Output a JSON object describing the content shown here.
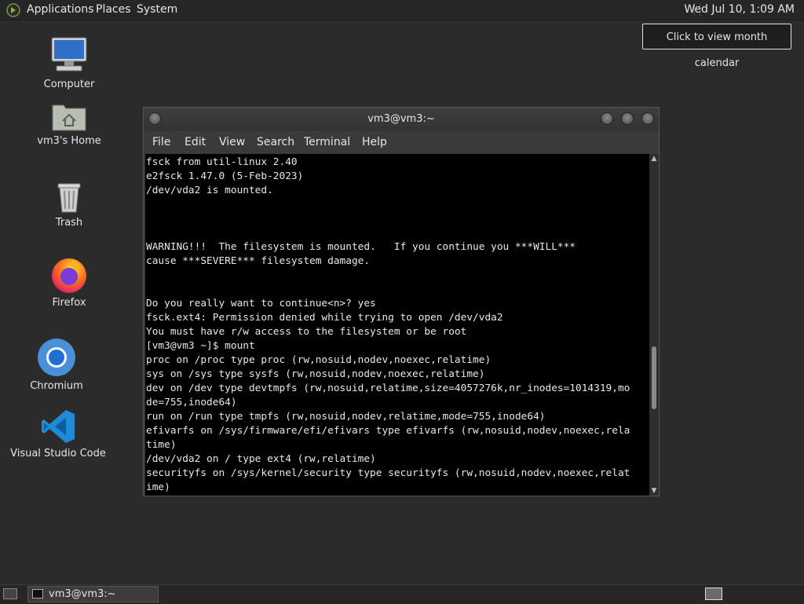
{
  "top_panel": {
    "menus": [
      "Applications",
      "Places",
      "System"
    ],
    "clock": "Wed Jul 10,  1:09 AM",
    "tooltip": "Click to view month calendar"
  },
  "desktop": {
    "icons": [
      {
        "label": "Computer",
        "icon": "computer-icon"
      },
      {
        "label": "vm3's Home",
        "icon": "home-folder-icon"
      },
      {
        "label": "Trash",
        "icon": "trash-icon"
      },
      {
        "label": "Firefox",
        "icon": "firefox-icon"
      },
      {
        "label": "Chromium",
        "icon": "chromium-icon"
      },
      {
        "label": "Visual Studio Code",
        "icon": "vscode-icon"
      }
    ]
  },
  "terminal": {
    "title": "vm3@vm3:~",
    "menu": [
      "File",
      "Edit",
      "View",
      "Search",
      "Terminal",
      "Help"
    ],
    "lines": [
      "fsck from util-linux 2.40",
      "e2fsck 1.47.0 (5-Feb-2023)",
      "/dev/vda2 is mounted.",
      "",
      "",
      "",
      "WARNING!!!  The filesystem is mounted.   If you continue you ***WILL***",
      "cause ***SEVERE*** filesystem damage.",
      "",
      "",
      "Do you really want to continue<n>? yes",
      "fsck.ext4: Permission denied while trying to open /dev/vda2",
      "You must have r/w access to the filesystem or be root",
      "[vm3@vm3 ~]$ mount",
      "proc on /proc type proc (rw,nosuid,nodev,noexec,relatime)",
      "sys on /sys type sysfs (rw,nosuid,nodev,noexec,relatime)",
      "dev on /dev type devtmpfs (rw,nosuid,relatime,size=4057276k,nr_inodes=1014319,mo",
      "de=755,inode64)",
      "run on /run type tmpfs (rw,nosuid,nodev,relatime,mode=755,inode64)",
      "efivarfs on /sys/firmware/efi/efivars type efivarfs (rw,nosuid,nodev,noexec,rela",
      "time)",
      "/dev/vda2 on / type ext4 (rw,relatime)",
      "securityfs on /sys/kernel/security type securityfs (rw,nosuid,nodev,noexec,relat",
      "ime)"
    ]
  },
  "taskbar": {
    "window_label": "vm3@vm3:~"
  }
}
